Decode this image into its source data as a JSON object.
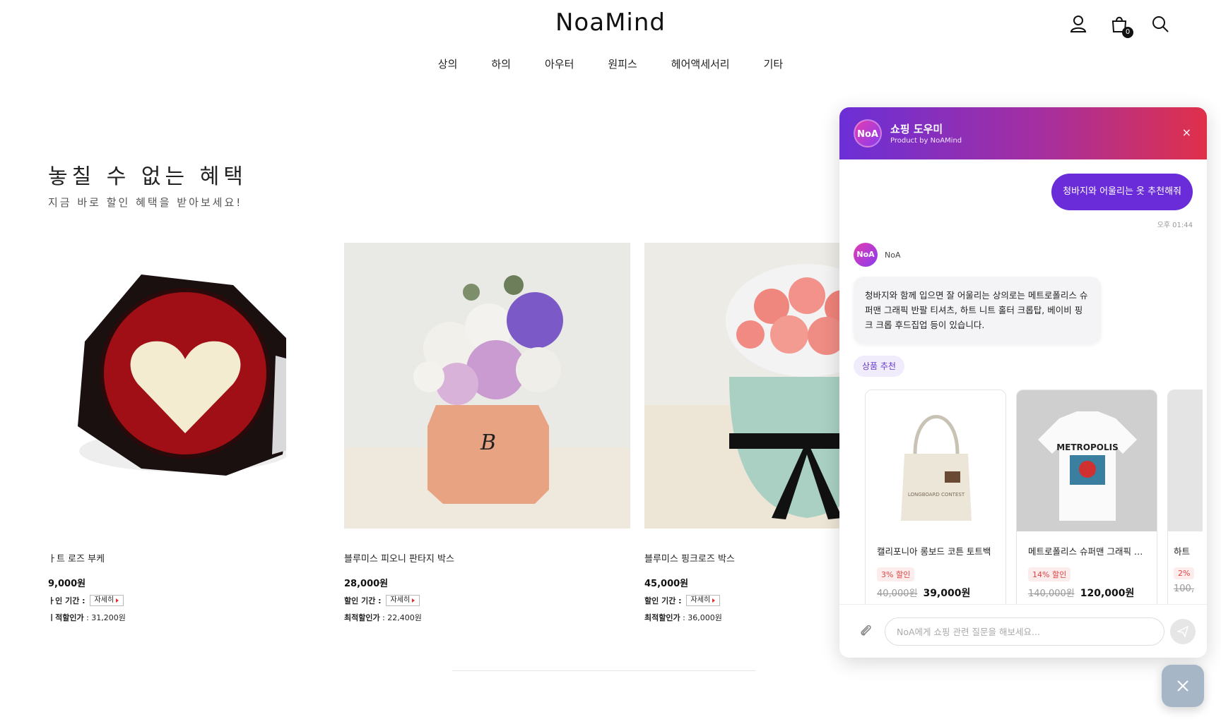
{
  "header": {
    "logo": "NoaMind",
    "cart_count": "0",
    "icons": [
      "user-icon",
      "shopping-bag-icon",
      "search-icon"
    ]
  },
  "nav": [
    "상의",
    "하의",
    "아우터",
    "원피스",
    "헤어액세서리",
    "기타"
  ],
  "section": {
    "title": "놓칠 수 없는 혜택",
    "subtitle": "지금 바로 할인 혜택을 받아보세요!"
  },
  "products": [
    {
      "name": "ㅏ트 로즈 부케",
      "price": "9,000원",
      "period_label": "ㅏ인 기간 :",
      "detail_label": "자세히",
      "best_label": "ㅣ적할인가",
      "best_price": ": 31,200원"
    },
    {
      "name": "블루미스 피오니 판타지 박스",
      "price": "28,000원",
      "period_label": "할인 기간 :",
      "detail_label": "자세히",
      "best_label": "최적할인가",
      "best_price": ": 22,400원"
    },
    {
      "name": "블루미스 핑크로즈 박스",
      "price": "45,000원",
      "period_label": "할인 기간 :",
      "detail_label": "자세히",
      "best_label": "최적할인가",
      "best_price": ": 36,000원"
    }
  ],
  "chat": {
    "title": "쇼핑 도우미",
    "subtitle": "Product by NoAMind",
    "avatar_text": "NoA",
    "close": "×",
    "user_message": "청바지와 어울리는 옷 추천해줘",
    "time": "오후 01:44",
    "bot_name": "NoA",
    "bot_message": "청바지와 함께 입으면 잘 어울리는 상의로는 메트로폴리스 슈퍼맨 그래픽 반팔 티셔츠, 하트 니트 홀터 크롭탑, 베이비 핑크 크롭 후드집업 등이 있습니다.",
    "rec_tag": "상품 추천",
    "rec_products": [
      {
        "name": "캘리포니아 롱보드 코튼 토트백",
        "discount": "3% 할인",
        "original": "40,000원",
        "price": "39,000원"
      },
      {
        "name": "메트로폴리스 슈퍼맨 그래픽 반...",
        "discount": "14% 할인",
        "original": "140,000원",
        "price": "120,000원"
      },
      {
        "name": "하트",
        "discount": "2%",
        "original": "100,",
        "price": ""
      }
    ],
    "input_placeholder": "NoA에게 쇼핑 관련 질문을 해보세요...",
    "print_labels": {
      "tote": "LONGBOARD CONTEST",
      "tshirt": "METROPOLIS"
    }
  },
  "colors": {
    "accent": "#6a2bd8",
    "header_gradient_start": "#6b2fd6",
    "header_gradient_end": "#e0304a",
    "discount": "#e04444"
  }
}
